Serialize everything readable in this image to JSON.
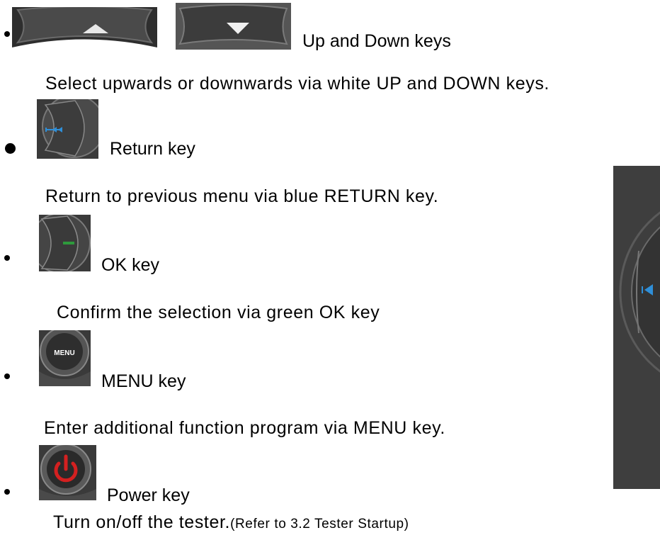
{
  "sections": [
    {
      "label": "Up and Down keys",
      "description": "Select upwards or downwards via white UP and DOWN keys.",
      "icons": [
        "up-key-icon",
        "down-key-icon"
      ]
    },
    {
      "label": "Return key",
      "description": "Return to previous menu via blue RETURN key.",
      "icons": [
        "return-key-icon"
      ]
    },
    {
      "label": "OK key",
      "description": "Confirm the selection via green OK key",
      "icons": [
        "ok-key-icon"
      ]
    },
    {
      "label": "MENU key",
      "description": "Enter additional function program via MENU key.",
      "icons": [
        "menu-key-icon"
      ],
      "icon_text": "MENU"
    },
    {
      "label": "Power key",
      "description": "Turn on/off the tester.",
      "note": "(Refer to 3.2 Tester Startup)",
      "icons": [
        "power-key-icon"
      ]
    }
  ],
  "colors": {
    "key_body": "#3a3a3a",
    "return_arrow": "#2f8fd8",
    "ok_mark": "#2e9a3c",
    "power_symbol": "#d42020",
    "side_panel": "#3e3e3e"
  }
}
